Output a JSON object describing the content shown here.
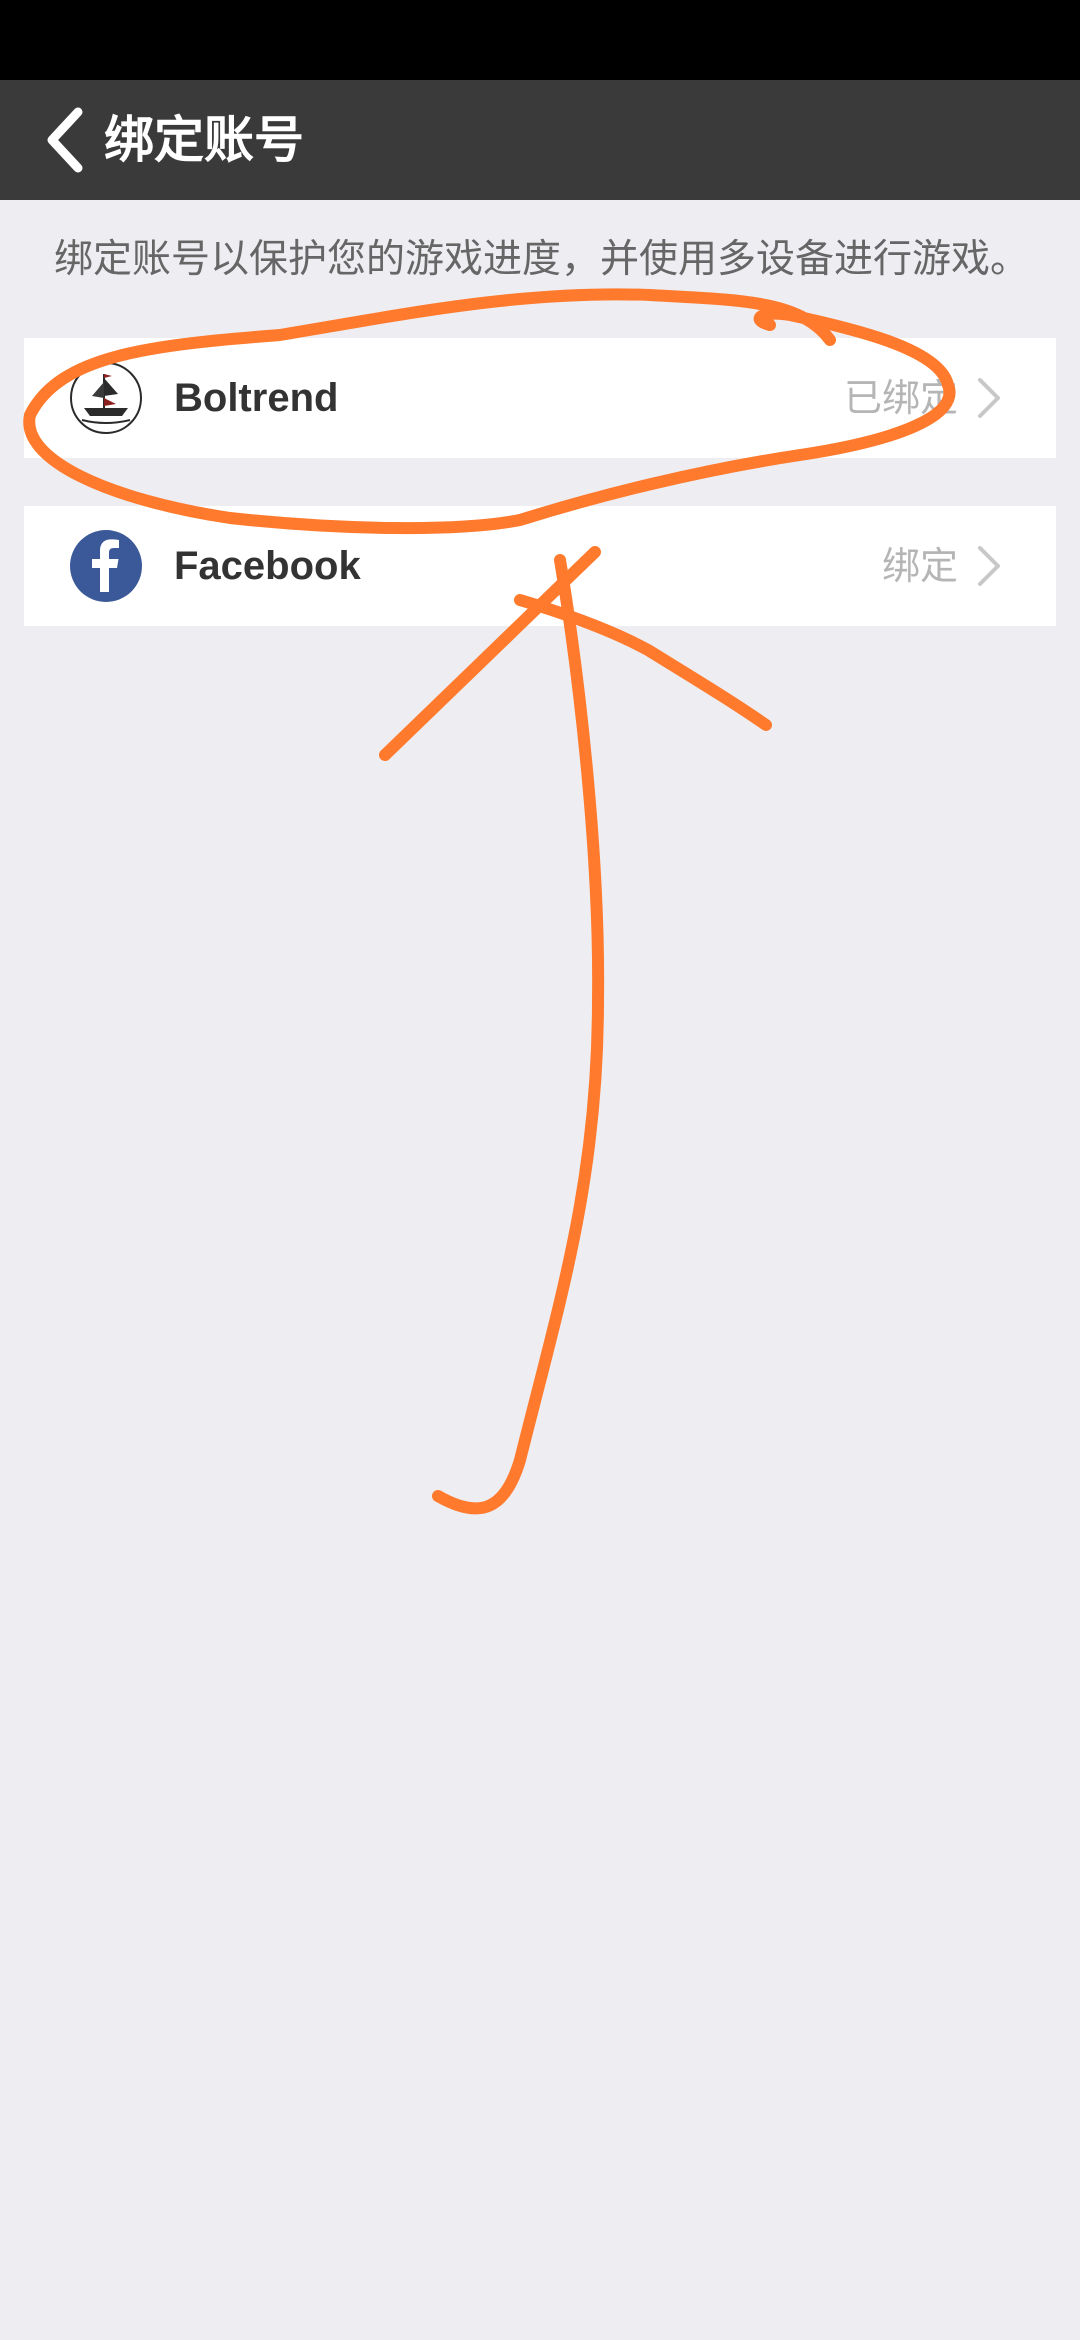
{
  "header": {
    "back_icon": "chevron-left-icon",
    "title": "绑定账号"
  },
  "description": "绑定账号以保护您的游戏进度，并使用多设备进行游戏。",
  "accounts": [
    {
      "name": "Boltrend",
      "status": "已绑定",
      "icon": "ship-logo-icon"
    },
    {
      "name": "Facebook",
      "status": "绑定",
      "icon": "facebook-icon"
    }
  ],
  "colors": {
    "status_bar": "#000000",
    "header": "#3a3a3a",
    "background": "#eeedf2",
    "annotation": "#ff7a2c",
    "facebook": "#3b5998"
  }
}
